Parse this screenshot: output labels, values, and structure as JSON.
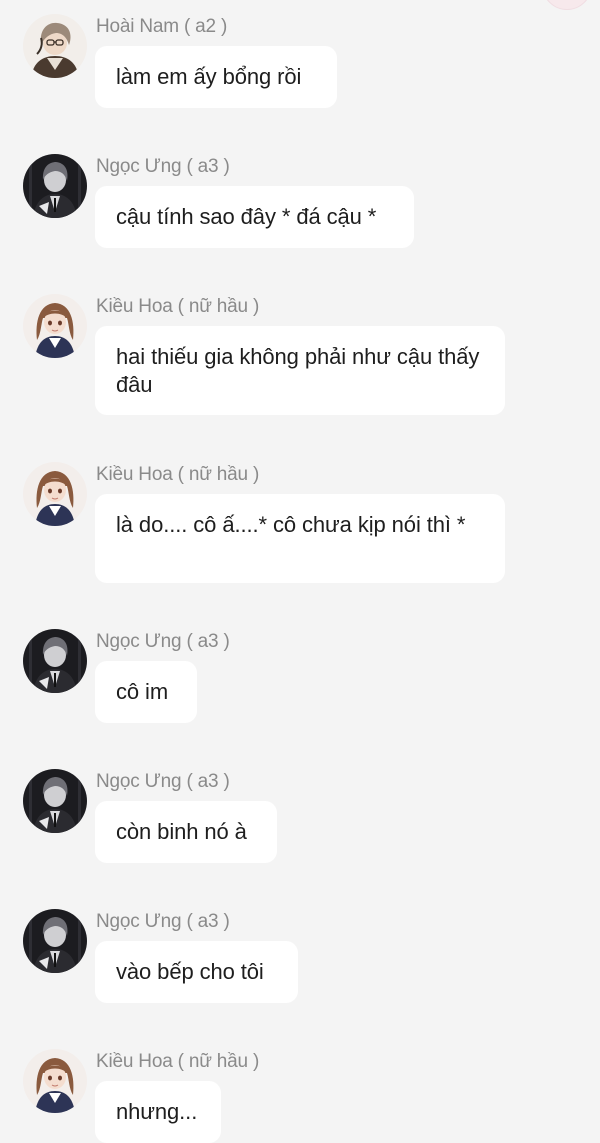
{
  "messages": [
    {
      "sender": "Hoài Nam ( a2 )",
      "text": "làm em ấy bổng rồi",
      "avatar_icon": "avatar-hoai-nam-icon"
    },
    {
      "sender": "Ngọc Ưng ( a3 )",
      "text": "cậu tính sao đây * đá cậu *",
      "avatar_icon": "avatar-ngoc-ung-icon"
    },
    {
      "sender": "Kiều Hoa ( nữ hầu )",
      "text": "hai thiếu gia không phải như cậu thấy đâu",
      "avatar_icon": "avatar-kieu-hoa-icon"
    },
    {
      "sender": "Kiều Hoa ( nữ hầu )",
      "text": "là do.... cô ấ....* cô chưa kịp nói thì *",
      "avatar_icon": "avatar-kieu-hoa-icon"
    },
    {
      "sender": "Ngọc Ưng ( a3 )",
      "text": "cô im",
      "avatar_icon": "avatar-ngoc-ung-icon"
    },
    {
      "sender": "Ngọc Ưng ( a3 )",
      "text": "còn binh nó à",
      "avatar_icon": "avatar-ngoc-ung-icon"
    },
    {
      "sender": "Ngọc Ưng ( a3 )",
      "text": "vào bếp cho tôi",
      "avatar_icon": "avatar-ngoc-ung-icon"
    },
    {
      "sender": "Kiều Hoa ( nữ hầu )",
      "text": "nhưng...",
      "avatar_icon": "avatar-kieu-hoa-icon"
    }
  ],
  "colors": {
    "background": "#f4f4f4",
    "bubble": "#ffffff",
    "sender_text": "#8a8a8a",
    "message_text": "#1e1e1e"
  }
}
